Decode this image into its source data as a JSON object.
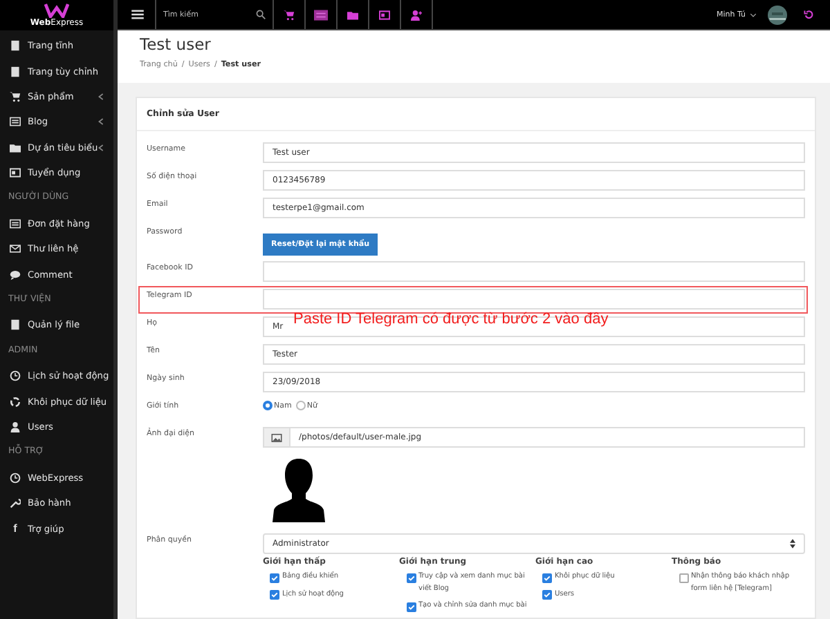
{
  "logo": {
    "text": "**Web**Express"
  },
  "search": {
    "placeholder": "Tìm kiếm"
  },
  "user": {
    "name": "Minh Tú"
  },
  "sidebar": {
    "items": [
      {
        "kind": "link",
        "label": "Trang tĩnh",
        "has_submenu": false
      },
      {
        "kind": "link",
        "label": "Trang tùy chỉnh",
        "has_submenu": false
      },
      {
        "kind": "link",
        "label": "Sản phẩm",
        "has_submenu": true
      },
      {
        "kind": "link",
        "label": "Blog",
        "has_submenu": true
      },
      {
        "kind": "link",
        "label": "Dự án tiêu biểu",
        "has_submenu": true
      },
      {
        "kind": "link",
        "label": "Tuyển dụng",
        "has_submenu": false
      },
      {
        "kind": "section",
        "label": "NGƯỜI DÙNG"
      },
      {
        "kind": "link",
        "label": "Đơn đặt hàng",
        "has_submenu": false
      },
      {
        "kind": "link",
        "label": "Thư liên hệ",
        "has_submenu": false
      },
      {
        "kind": "link",
        "label": "Comment",
        "has_submenu": false
      },
      {
        "kind": "section",
        "label": "THƯ VIỆN"
      },
      {
        "kind": "link",
        "label": "Quản lý file",
        "has_submenu": false
      },
      {
        "kind": "section",
        "label": "ADMIN"
      },
      {
        "kind": "link",
        "label": "Lịch sử hoạt động",
        "has_submenu": false
      },
      {
        "kind": "link",
        "label": "Khôi phục dữ liệu",
        "has_submenu": false
      },
      {
        "kind": "link",
        "label": "Users",
        "has_submenu": false
      },
      {
        "kind": "section",
        "label": "HỖ TRỢ"
      },
      {
        "kind": "link",
        "label": "WebExpress",
        "has_submenu": false
      },
      {
        "kind": "link",
        "label": "Bảo hành",
        "has_submenu": false
      },
      {
        "kind": "link",
        "label": "Trợ giúp",
        "has_submenu": false,
        "icon_char": "f"
      }
    ]
  },
  "page": {
    "title": "Test user",
    "breadcrumb": [
      {
        "kind": "link",
        "label": "Trang chủ",
        "current": false
      },
      {
        "kind": "separator",
        "label": "/"
      },
      {
        "kind": "link",
        "label": "Users",
        "current": false
      },
      {
        "kind": "separator",
        "label": "/"
      },
      {
        "kind": "link",
        "label": "Test user",
        "current": true
      }
    ]
  },
  "card": {
    "title": "Chỉnh sửa User",
    "fields": [
      {
        "kind": "input",
        "label": "Username",
        "value": "Test user"
      },
      {
        "kind": "input",
        "label": "Số điện thoại",
        "value": "0123456789"
      },
      {
        "kind": "input",
        "label": "Email",
        "value": "testerpe1@gmail.com"
      },
      {
        "kind": "button",
        "label": "Password",
        "button": "Reset/Đặt lại mật khẩu"
      },
      {
        "kind": "input",
        "label": "Facebook ID"
      },
      {
        "kind": "input",
        "label": "Telegram ID",
        "highlighted": true
      },
      {
        "kind": "input",
        "label": "Họ",
        "value": "Mr"
      },
      {
        "kind": "input",
        "label": "Tên",
        "value": "Tester"
      },
      {
        "kind": "input",
        "label": "Ngày sinh",
        "value": "23/09/2018"
      },
      {
        "kind": "radio",
        "label": "Giới tính",
        "options": [
          {
            "label": "Nam",
            "selected": true
          },
          {
            "label": "Nữ",
            "selected": false
          }
        ]
      },
      {
        "kind": "file",
        "label": "Ảnh đại diện",
        "value": "/photos/default/user-male.jpg"
      },
      {
        "kind": "select",
        "label": "Phân quyền",
        "value": "Administrator"
      }
    ],
    "permission_groups": [
      {
        "title": "Giới hạn thấp",
        "items": [
          {
            "label": "Bảng điều khiển",
            "checked": true
          },
          {
            "label": "Lịch sử hoạt động",
            "checked": true
          }
        ]
      },
      {
        "title": "Giới hạn trung",
        "items": [
          {
            "label": "Truy cập và xem danh mục bài viết Blog",
            "checked": true
          },
          {
            "label": "Tạo và chỉnh sửa danh mục bài",
            "checked": true
          }
        ]
      },
      {
        "title": "Giới hạn cao",
        "items": [
          {
            "label": "Khôi phục dữ liệu",
            "checked": true
          },
          {
            "label": "Users",
            "checked": true
          }
        ]
      },
      {
        "title": "Thông báo",
        "items": [
          {
            "label": "Nhận thông báo khách nhập form liên hệ [Telegram]",
            "checked": false
          }
        ]
      }
    ]
  },
  "annotation": {
    "text": "Paste ID Telegram có được từ bước 2 vào đây"
  }
}
